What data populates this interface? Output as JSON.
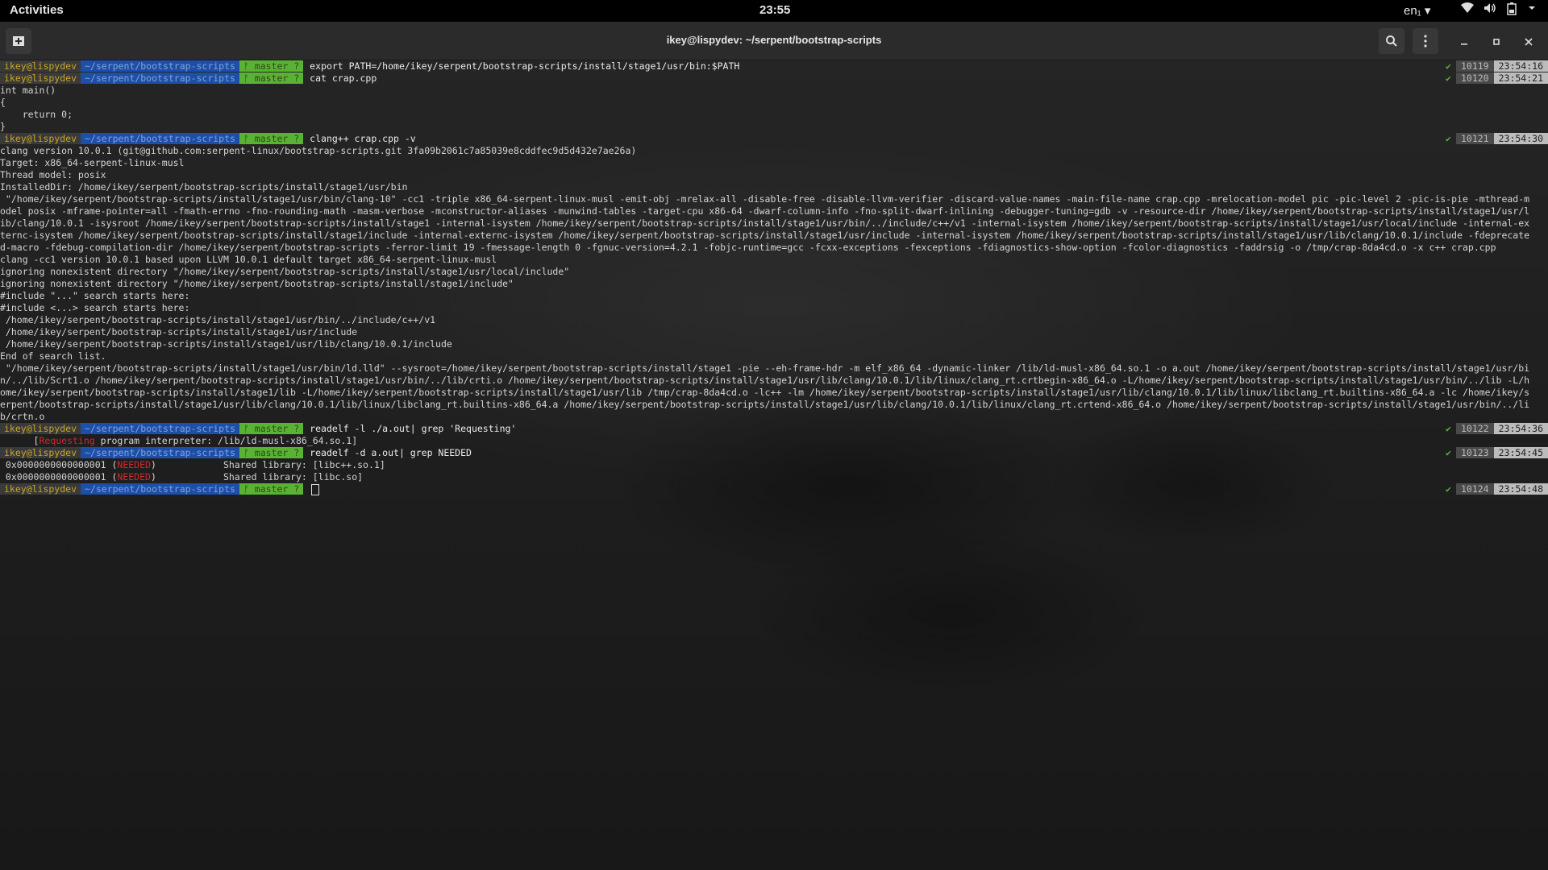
{
  "topbar": {
    "activities": "Activities",
    "clock": "23:55",
    "lang": "en₁ ▾"
  },
  "tray_icons": [
    "wifi-icon",
    "volume-icon",
    "battery-icon",
    "system-menu-icon"
  ],
  "window": {
    "title": "ikey@lispydev: ~/serpent/bootstrap-scripts"
  },
  "prompt": {
    "user": "ikey@lispydev",
    "path": "~/serpent/bootstrap-scripts",
    "git": "ᚠ master ?"
  },
  "colors": {
    "user_fg": "#c7a628",
    "path_bg": "#1e4fa8",
    "git_bg": "#5ab234",
    "ok_green": "#58b23a",
    "error_red": "#cc2a2a"
  },
  "lines": [
    {
      "type": "prompt",
      "cmd": "export PATH=/home/ikey/serpent/bootstrap-scripts/install/stage1/usr/bin:$PATH",
      "hist": "10119",
      "time": "23:54:16"
    },
    {
      "type": "prompt",
      "cmd": "cat crap.cpp",
      "hist": "10120",
      "time": "23:54:21"
    },
    {
      "type": "out",
      "text": "int main()"
    },
    {
      "type": "out",
      "text": "{"
    },
    {
      "type": "out",
      "text": "    return 0;"
    },
    {
      "type": "out",
      "text": "}"
    },
    {
      "type": "prompt",
      "cmd": "clang++ crap.cpp -v",
      "hist": "10121",
      "time": "23:54:30"
    },
    {
      "type": "out",
      "text": "clang version 10.0.1 (git@github.com:serpent-linux/bootstrap-scripts.git 3fa09b2061c7a85039e8cddfec9d5d432e7ae26a)"
    },
    {
      "type": "out",
      "text": "Target: x86_64-serpent-linux-musl"
    },
    {
      "type": "out",
      "text": "Thread model: posix"
    },
    {
      "type": "out",
      "text": "InstalledDir: /home/ikey/serpent/bootstrap-scripts/install/stage1/usr/bin"
    },
    {
      "type": "out",
      "text": " \"/home/ikey/serpent/bootstrap-scripts/install/stage1/usr/bin/clang-10\" -cc1 -triple x86_64-serpent-linux-musl -emit-obj -mrelax-all -disable-free -disable-llvm-verifier -discard-value-names -main-file-name crap.cpp -mrelocation-model pic -pic-level 2 -pic-is-pie -mthread-m"
    },
    {
      "type": "out",
      "text": "odel posix -mframe-pointer=all -fmath-errno -fno-rounding-math -masm-verbose -mconstructor-aliases -munwind-tables -target-cpu x86-64 -dwarf-column-info -fno-split-dwarf-inlining -debugger-tuning=gdb -v -resource-dir /home/ikey/serpent/bootstrap-scripts/install/stage1/usr/l"
    },
    {
      "type": "out",
      "text": "ib/clang/10.0.1 -isysroot /home/ikey/serpent/bootstrap-scripts/install/stage1 -internal-isystem /home/ikey/serpent/bootstrap-scripts/install/stage1/usr/bin/../include/c++/v1 -internal-isystem /home/ikey/serpent/bootstrap-scripts/install/stage1/usr/local/include -internal-ex"
    },
    {
      "type": "out",
      "text": "ternc-isystem /home/ikey/serpent/bootstrap-scripts/install/stage1/include -internal-externc-isystem /home/ikey/serpent/bootstrap-scripts/install/stage1/usr/include -internal-isystem /home/ikey/serpent/bootstrap-scripts/install/stage1/usr/lib/clang/10.0.1/include -fdeprecate"
    },
    {
      "type": "out",
      "text": "d-macro -fdebug-compilation-dir /home/ikey/serpent/bootstrap-scripts -ferror-limit 19 -fmessage-length 0 -fgnuc-version=4.2.1 -fobjc-runtime=gcc -fcxx-exceptions -fexceptions -fdiagnostics-show-option -fcolor-diagnostics -faddrsig -o /tmp/crap-8da4cd.o -x c++ crap.cpp"
    },
    {
      "type": "out",
      "text": "clang -cc1 version 10.0.1 based upon LLVM 10.0.1 default target x86_64-serpent-linux-musl"
    },
    {
      "type": "out",
      "text": "ignoring nonexistent directory \"/home/ikey/serpent/bootstrap-scripts/install/stage1/usr/local/include\""
    },
    {
      "type": "out",
      "text": "ignoring nonexistent directory \"/home/ikey/serpent/bootstrap-scripts/install/stage1/include\""
    },
    {
      "type": "out",
      "text": "#include \"...\" search starts here:"
    },
    {
      "type": "out",
      "text": "#include <...> search starts here:"
    },
    {
      "type": "out",
      "text": " /home/ikey/serpent/bootstrap-scripts/install/stage1/usr/bin/../include/c++/v1"
    },
    {
      "type": "out",
      "text": " /home/ikey/serpent/bootstrap-scripts/install/stage1/usr/include"
    },
    {
      "type": "out",
      "text": " /home/ikey/serpent/bootstrap-scripts/install/stage1/usr/lib/clang/10.0.1/include"
    },
    {
      "type": "out",
      "text": "End of search list."
    },
    {
      "type": "out",
      "text": " \"/home/ikey/serpent/bootstrap-scripts/install/stage1/usr/bin/ld.lld\" --sysroot=/home/ikey/serpent/bootstrap-scripts/install/stage1 -pie --eh-frame-hdr -m elf_x86_64 -dynamic-linker /lib/ld-musl-x86_64.so.1 -o a.out /home/ikey/serpent/bootstrap-scripts/install/stage1/usr/bi"
    },
    {
      "type": "out",
      "text": "n/../lib/Scrt1.o /home/ikey/serpent/bootstrap-scripts/install/stage1/usr/bin/../lib/crti.o /home/ikey/serpent/bootstrap-scripts/install/stage1/usr/lib/clang/10.0.1/lib/linux/clang_rt.crtbegin-x86_64.o -L/home/ikey/serpent/bootstrap-scripts/install/stage1/usr/bin/../lib -L/h"
    },
    {
      "type": "out",
      "text": "ome/ikey/serpent/bootstrap-scripts/install/stage1/lib -L/home/ikey/serpent/bootstrap-scripts/install/stage1/usr/lib /tmp/crap-8da4cd.o -lc++ -lm /home/ikey/serpent/bootstrap-scripts/install/stage1/usr/lib/clang/10.0.1/lib/linux/libclang_rt.builtins-x86_64.a -lc /home/ikey/s"
    },
    {
      "type": "out",
      "text": "erpent/bootstrap-scripts/install/stage1/usr/lib/clang/10.0.1/lib/linux/libclang_rt.builtins-x86_64.a /home/ikey/serpent/bootstrap-scripts/install/stage1/usr/lib/clang/10.0.1/lib/linux/clang_rt.crtend-x86_64.o /home/ikey/serpent/bootstrap-scripts/install/stage1/usr/bin/../li"
    },
    {
      "type": "out",
      "text": "b/crtn.o"
    },
    {
      "type": "prompt",
      "cmd": "readelf -l ./a.out| grep 'Requesting'",
      "hist": "10122",
      "time": "23:54:36"
    },
    {
      "type": "out",
      "pre": "      [",
      "red": "Requesting",
      "post": " program interpreter: /lib/ld-musl-x86_64.so.1]"
    },
    {
      "type": "prompt",
      "cmd": "readelf -d a.out| grep NEEDED",
      "hist": "10123",
      "time": "23:54:45"
    },
    {
      "type": "out",
      "pre": " 0x0000000000000001 (",
      "red": "NEEDED",
      "post": ")            Shared library: [libc++.so.1]"
    },
    {
      "type": "out",
      "pre": " 0x0000000000000001 (",
      "red": "NEEDED",
      "post": ")            Shared library: [libc.so]"
    },
    {
      "type": "prompt",
      "cmd": "",
      "hist": "10124",
      "time": "23:54:48",
      "cursor": true
    }
  ]
}
